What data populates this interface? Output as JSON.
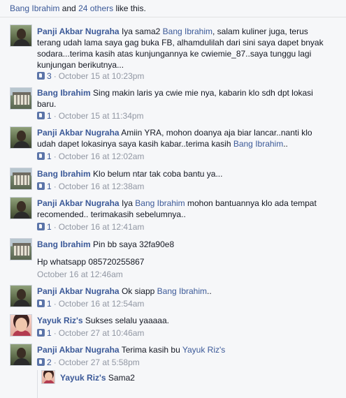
{
  "likes_bar": {
    "liker": "Bang Ibrahim",
    "and": " and ",
    "others": "24 others",
    "suffix": " like this."
  },
  "comments": [
    {
      "author": "Panji Akbar Nugraha",
      "text_a": "Iya sama2 ",
      "mention": "Bang Ibrahim",
      "text_b": ", salam kuliner juga, terus terang udah lama saya gag buka FB, alhamdulilah dari sini saya dapet bnyak sodara...terima kasih atas kunjungannya ke cwiemie_87..saya tunggu lagi kunjungan berikutnya...",
      "likes": "3",
      "time": "October 15 at 10:23pm"
    },
    {
      "author": "Bang Ibrahim",
      "text": "Sing makin laris ya cwie mie nya, kabarin klo sdh dpt lokasi baru.",
      "likes": "1",
      "time": "October 15 at 11:34pm"
    },
    {
      "author": "Panji Akbar Nugraha",
      "text_a": "Amiin YRA, mohon doanya aja biar lancar..nanti klo udah dapet lokasinya saya kasih kabar..terima kasih ",
      "mention": "Bang Ibrahim",
      "text_b": "..",
      "likes": "1",
      "time": "October 16 at 12:02am"
    },
    {
      "author": "Bang Ibrahim",
      "text": "Klo belum ntar tak coba bantu ya...",
      "likes": "1",
      "time": "October 16 at 12:38am"
    },
    {
      "author": "Panji Akbar Nugraha",
      "text_a": "Iya ",
      "mention": "Bang Ibrahim",
      "text_b": " mohon bantuannya klo ada tempat recomended.. terimakasih sebelumnya..",
      "likes": "1",
      "time": "October 16 at 12:41am"
    },
    {
      "author": "Bang Ibrahim",
      "text": "Pin bb saya 32fa90e8",
      "text2": "Hp whatsapp 085720255867",
      "time": "October 16 at 12:46am"
    },
    {
      "author": "Panji Akbar Nugraha",
      "text_a": "Ok siapp ",
      "mention": "Bang Ibrahim",
      "text_b": "..",
      "likes": "1",
      "time": "October 16 at 12:54am"
    },
    {
      "author": "Yayuk Riz's",
      "text": "Sukses selalu yaaaaa.",
      "likes": "1",
      "time": "October 27 at 10:46am"
    },
    {
      "author": "Panji Akbar Nugraha",
      "text_a": "Terima kasih bu ",
      "mention": "Yayuk Riz's",
      "text_b": "",
      "likes": "2",
      "time": "October 27 at 5:58pm"
    }
  ],
  "reply": {
    "author": "Yayuk Riz's",
    "text": "Sama2"
  },
  "separator": "·"
}
